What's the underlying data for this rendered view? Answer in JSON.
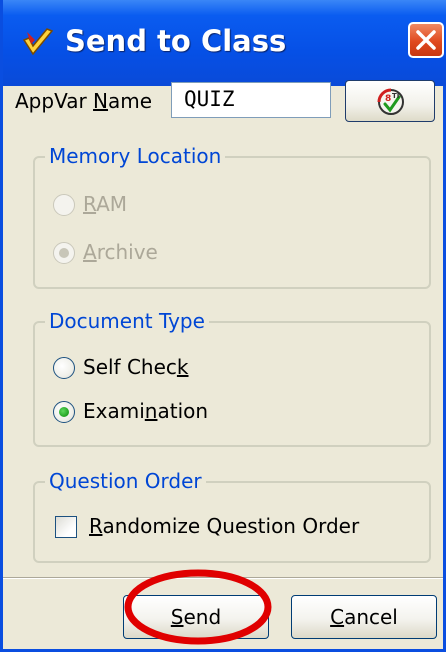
{
  "window": {
    "title": "Send to Class"
  },
  "appvar": {
    "label_prefix": "AppVar ",
    "label_mnemonic": "N",
    "label_rest": "ame",
    "value": "QUIZ"
  },
  "memory_location": {
    "legend": "Memory Location",
    "options": [
      {
        "mnemonic": "R",
        "rest": "AM",
        "selected": false,
        "disabled": true
      },
      {
        "mnemonic": "A",
        "rest": "rchive",
        "selected": true,
        "disabled": true
      }
    ]
  },
  "document_type": {
    "legend": "Document Type",
    "options": [
      {
        "prefix": "Self Chec",
        "mnemonic": "k",
        "rest": "",
        "selected": false,
        "disabled": false
      },
      {
        "prefix": "Exami",
        "mnemonic": "n",
        "rest": "ation",
        "selected": true,
        "disabled": false
      }
    ]
  },
  "question_order": {
    "legend": "Question Order",
    "checkbox": {
      "mnemonic": "R",
      "rest": "andomize Question Order",
      "checked": false
    }
  },
  "buttons": {
    "send": {
      "mnemonic": "S",
      "rest": "end"
    },
    "cancel": {
      "mnemonic": "C",
      "rest": "ancel"
    }
  },
  "icons": {
    "title": "ti-checkmark-icon",
    "close": "close-icon",
    "ti_button": "ti-connect-icon"
  },
  "colors": {
    "titlebar": "#0650e6",
    "close": "#e0491f",
    "legend_text": "#0046d5",
    "annotation": "#e00000"
  }
}
